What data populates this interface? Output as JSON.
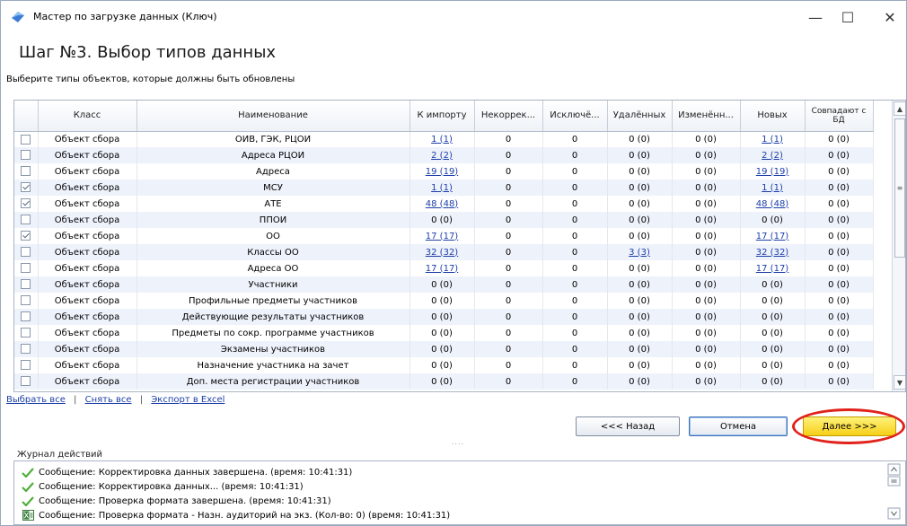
{
  "window": {
    "title": "Мастер по загрузке данных (Ключ)",
    "controls": {
      "minimize": "—",
      "maximize": "☐",
      "close": "✕"
    }
  },
  "step_title": "Шаг №3.  Выбор типов данных",
  "subtitle": "Выберите типы объектов, которые должны быть обновлены",
  "table": {
    "columns": [
      "",
      "Класс",
      "Наименование",
      "К импорту",
      "Некоррек...",
      "Исключё...",
      "Удалённых",
      "Изменённ...",
      "Новых",
      "Совпадают с БД"
    ],
    "rows": [
      {
        "checked": false,
        "class": "Объект сбора",
        "name": "ОИВ, ГЭК, РЦОИ",
        "import": "1 (1)",
        "import_link": true,
        "incorrect": "0",
        "excluded": "0",
        "deleted": "0 (0)",
        "deleted_link": false,
        "changed": "0 (0)",
        "new": "1 (1)",
        "new_link": true,
        "match": "0 (0)"
      },
      {
        "checked": false,
        "class": "Объект сбора",
        "name": "Адреса РЦОИ",
        "import": "2 (2)",
        "import_link": true,
        "incorrect": "0",
        "excluded": "0",
        "deleted": "0 (0)",
        "deleted_link": false,
        "changed": "0 (0)",
        "new": "2 (2)",
        "new_link": true,
        "match": "0 (0)"
      },
      {
        "checked": false,
        "class": "Объект сбора",
        "name": "Адреса",
        "import": "19 (19)",
        "import_link": true,
        "incorrect": "0",
        "excluded": "0",
        "deleted": "0 (0)",
        "deleted_link": false,
        "changed": "0 (0)",
        "new": "19 (19)",
        "new_link": true,
        "match": "0 (0)"
      },
      {
        "checked": true,
        "class": "Объект сбора",
        "name": "МСУ",
        "import": "1 (1)",
        "import_link": true,
        "incorrect": "0",
        "excluded": "0",
        "deleted": "0 (0)",
        "deleted_link": false,
        "changed": "0 (0)",
        "new": "1 (1)",
        "new_link": true,
        "match": "0 (0)"
      },
      {
        "checked": true,
        "class": "Объект сбора",
        "name": "АТЕ",
        "import": "48 (48)",
        "import_link": true,
        "incorrect": "0",
        "excluded": "0",
        "deleted": "0 (0)",
        "deleted_link": false,
        "changed": "0 (0)",
        "new": "48 (48)",
        "new_link": true,
        "match": "0 (0)"
      },
      {
        "checked": false,
        "class": "Объект сбора",
        "name": "ППОИ",
        "import": "0 (0)",
        "import_link": false,
        "incorrect": "0",
        "excluded": "0",
        "deleted": "0 (0)",
        "deleted_link": false,
        "changed": "0 (0)",
        "new": "0 (0)",
        "new_link": false,
        "match": "0 (0)"
      },
      {
        "checked": true,
        "class": "Объект сбора",
        "name": "ОО",
        "import": "17 (17)",
        "import_link": true,
        "incorrect": "0",
        "excluded": "0",
        "deleted": "0 (0)",
        "deleted_link": false,
        "changed": "0 (0)",
        "new": "17 (17)",
        "new_link": true,
        "match": "0 (0)"
      },
      {
        "checked": false,
        "class": "Объект сбора",
        "name": "Классы ОО",
        "import": "32 (32)",
        "import_link": true,
        "incorrect": "0",
        "excluded": "0",
        "deleted": "3 (3)",
        "deleted_link": true,
        "changed": "0 (0)",
        "new": "32 (32)",
        "new_link": true,
        "match": "0 (0)"
      },
      {
        "checked": false,
        "class": "Объект сбора",
        "name": "Адреса ОО",
        "import": "17 (17)",
        "import_link": true,
        "incorrect": "0",
        "excluded": "0",
        "deleted": "0 (0)",
        "deleted_link": false,
        "changed": "0 (0)",
        "new": "17 (17)",
        "new_link": true,
        "match": "0 (0)"
      },
      {
        "checked": false,
        "class": "Объект сбора",
        "name": "Участники",
        "import": "0 (0)",
        "import_link": false,
        "incorrect": "0",
        "excluded": "0",
        "deleted": "0 (0)",
        "deleted_link": false,
        "changed": "0 (0)",
        "new": "0 (0)",
        "new_link": false,
        "match": "0 (0)"
      },
      {
        "checked": false,
        "class": "Объект сбора",
        "name": "Профильные предметы участников",
        "import": "0 (0)",
        "import_link": false,
        "incorrect": "0",
        "excluded": "0",
        "deleted": "0 (0)",
        "deleted_link": false,
        "changed": "0 (0)",
        "new": "0 (0)",
        "new_link": false,
        "match": "0 (0)"
      },
      {
        "checked": false,
        "class": "Объект сбора",
        "name": "Действующие результаты участников",
        "import": "0 (0)",
        "import_link": false,
        "incorrect": "0",
        "excluded": "0",
        "deleted": "0 (0)",
        "deleted_link": false,
        "changed": "0 (0)",
        "new": "0 (0)",
        "new_link": false,
        "match": "0 (0)"
      },
      {
        "checked": false,
        "class": "Объект сбора",
        "name": "Предметы по сокр. программе участников",
        "import": "0 (0)",
        "import_link": false,
        "incorrect": "0",
        "excluded": "0",
        "deleted": "0 (0)",
        "deleted_link": false,
        "changed": "0 (0)",
        "new": "0 (0)",
        "new_link": false,
        "match": "0 (0)"
      },
      {
        "checked": false,
        "class": "Объект сбора",
        "name": "Экзамены участников",
        "import": "0 (0)",
        "import_link": false,
        "incorrect": "0",
        "excluded": "0",
        "deleted": "0 (0)",
        "deleted_link": false,
        "changed": "0 (0)",
        "new": "0 (0)",
        "new_link": false,
        "match": "0 (0)"
      },
      {
        "checked": false,
        "class": "Объект сбора",
        "name": "Назначение участника на зачет",
        "import": "0 (0)",
        "import_link": false,
        "incorrect": "0",
        "excluded": "0",
        "deleted": "0 (0)",
        "deleted_link": false,
        "changed": "0 (0)",
        "new": "0 (0)",
        "new_link": false,
        "match": "0 (0)"
      },
      {
        "checked": false,
        "class": "Объект сбора",
        "name": "Доп. места регистрации участников",
        "import": "0 (0)",
        "import_link": false,
        "incorrect": "0",
        "excluded": "0",
        "deleted": "0 (0)",
        "deleted_link": false,
        "changed": "0 (0)",
        "new": "0 (0)",
        "new_link": false,
        "match": "0 (0)"
      }
    ]
  },
  "links": {
    "select_all": "Выбрать все",
    "deselect_all": "Снять все",
    "export_excel": "Экспорт в Excel",
    "separator": "|"
  },
  "buttons": {
    "back": "<<< Назад",
    "cancel": "Отмена",
    "next": "Далее >>>"
  },
  "log": {
    "title": "Журнал действий",
    "entries": [
      {
        "icon": "check-icon",
        "text": "Сообщение: Корректировка данных завершена. (время: 10:41:31)"
      },
      {
        "icon": "check-icon",
        "text": "Сообщение: Корректировка данных... (время: 10:41:31)"
      },
      {
        "icon": "check-icon",
        "text": "Сообщение: Проверка формата завершена. (время: 10:41:31)"
      },
      {
        "icon": "excel-icon",
        "text": "Сообщение: Проверка формата - Назн. аудиторий на экз.  (Кол-во: 0) (время: 10:41:31)"
      }
    ]
  },
  "colors": {
    "link": "#1b3ea8",
    "row_alt": "#eef2fb",
    "next_button": "#f6cf18",
    "highlight_ring": "#e0221b",
    "check_icon": "#4fae3a"
  }
}
